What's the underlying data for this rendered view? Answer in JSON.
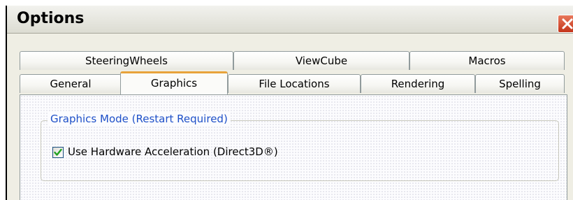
{
  "window": {
    "title": "Options",
    "close_icon": "close-icon"
  },
  "tabs": {
    "back_row": [
      {
        "label": "SteeringWheels"
      },
      {
        "label": "ViewCube"
      },
      {
        "label": "Macros"
      }
    ],
    "front_row": [
      {
        "label": "General"
      },
      {
        "label": "Graphics",
        "selected": true
      },
      {
        "label": "File Locations"
      },
      {
        "label": "Rendering"
      },
      {
        "label": "Spelling"
      }
    ]
  },
  "graphics_mode": {
    "group_title": "Graphics Mode (Restart Required)",
    "hardware_acceleration": {
      "label": "Use Hardware Acceleration (Direct3D®)",
      "checked": true
    }
  },
  "colors": {
    "selected_tab_accent": "#e8a33b",
    "group_title": "#1e50c8",
    "close_button": "#c4351a",
    "checkmark": "#21a121"
  }
}
